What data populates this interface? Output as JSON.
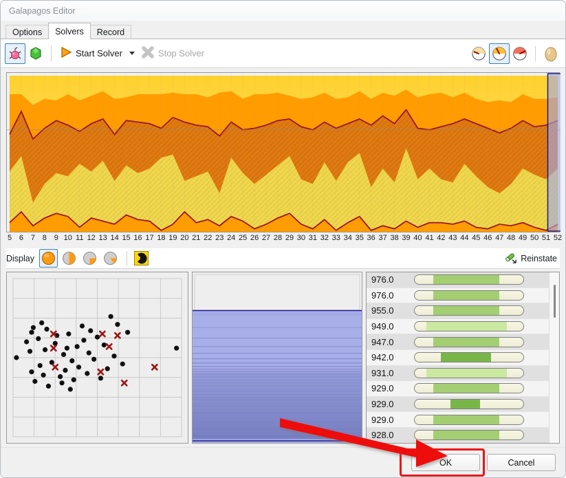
{
  "window": {
    "title": "Galapagos Editor"
  },
  "tabs": [
    {
      "label": "Options",
      "active": false
    },
    {
      "label": "Solvers",
      "active": true
    },
    {
      "label": "Record",
      "active": false
    }
  ],
  "toolbar": {
    "bug_icon": "bug-icon",
    "gem_icon": "gem-icon",
    "start_label": "Start Solver",
    "start_icon": "play-triangle-icon",
    "start_dropdown_icon": "chevron-down-icon",
    "stop_label": "Stop Solver",
    "stop_icon": "x-cross-icon",
    "stop_enabled": false,
    "right_icons": [
      {
        "name": "gauge-slow-icon",
        "selected": false
      },
      {
        "name": "gauge-medium-icon",
        "selected": true
      },
      {
        "name": "gauge-fast-icon",
        "selected": false
      },
      {
        "name": "egg-icon",
        "selected": false
      }
    ]
  },
  "display": {
    "label": "Display",
    "buttons": [
      {
        "name": "display-full-icon",
        "fill": 1.0,
        "selected": true
      },
      {
        "name": "display-half-icon",
        "fill": 0.5,
        "selected": false
      },
      {
        "name": "display-quarter-icon",
        "fill": 0.25,
        "selected": false
      },
      {
        "name": "display-wedge-icon",
        "fill": 0.12,
        "selected": false
      }
    ],
    "radiation_icon": "radiation-icon",
    "reinstate_label": "Reinstate",
    "reinstate_icon": "reinstate-icon"
  },
  "chart_data": {
    "type": "area",
    "title": "",
    "xlabel": "",
    "ylabel": "",
    "grid": true,
    "legend": false,
    "selected_x": 52,
    "colors": {
      "band_top": "#FFD94A",
      "band_upper": "#FF9C00",
      "band_mid": "#E07A10",
      "band_lower": "#E8D24B",
      "line": "#9B1616",
      "background": "#FFFFFF",
      "selection": "#9FA8E8"
    },
    "x": [
      5,
      6,
      7,
      8,
      9,
      10,
      11,
      12,
      13,
      14,
      15,
      16,
      17,
      18,
      19,
      20,
      21,
      22,
      23,
      24,
      25,
      26,
      27,
      28,
      29,
      30,
      31,
      32,
      33,
      34,
      35,
      36,
      37,
      38,
      39,
      40,
      41,
      42,
      43,
      44,
      45,
      46,
      47,
      48,
      49,
      50,
      51,
      52
    ],
    "series": [
      {
        "name": "maximum",
        "values": [
          100,
          100,
          100,
          100,
          100,
          100,
          100,
          100,
          100,
          100,
          100,
          100,
          100,
          100,
          100,
          100,
          100,
          100,
          100,
          100,
          100,
          100,
          100,
          100,
          100,
          100,
          100,
          100,
          100,
          100,
          100,
          100,
          100,
          100,
          100,
          100,
          100,
          100,
          100,
          100,
          100,
          100,
          100,
          100,
          100,
          100,
          100,
          100
        ]
      },
      {
        "name": "upper-quartile",
        "values": [
          88,
          88,
          81,
          85,
          84,
          88,
          84,
          87,
          90,
          85,
          86,
          88,
          88,
          88,
          89,
          88,
          88,
          86,
          89,
          90,
          85,
          88,
          88,
          89,
          87,
          85,
          86,
          89,
          85,
          86,
          90,
          85,
          89,
          87,
          91,
          86,
          88,
          89,
          86,
          89,
          85,
          83,
          84,
          83,
          88,
          85,
          85,
          86
        ]
      },
      {
        "name": "median",
        "values": [
          62,
          77,
          59,
          66,
          71,
          68,
          64,
          69,
          72,
          62,
          71,
          70,
          69,
          66,
          73,
          70,
          68,
          67,
          61,
          70,
          65,
          66,
          68,
          71,
          72,
          67,
          65,
          70,
          66,
          69,
          72,
          68,
          74,
          69,
          78,
          66,
          65,
          67,
          69,
          72,
          69,
          66,
          63,
          66,
          71,
          67,
          68,
          71
        ]
      },
      {
        "name": "lower-quartile",
        "values": [
          38,
          48,
          18,
          30,
          37,
          35,
          43,
          38,
          45,
          32,
          42,
          37,
          40,
          47,
          49,
          32,
          35,
          38,
          24,
          47,
          37,
          30,
          36,
          42,
          48,
          33,
          30,
          44,
          32,
          44,
          50,
          28,
          40,
          31,
          53,
          33,
          40,
          33,
          31,
          43,
          35,
          28,
          24,
          30,
          40,
          36,
          33,
          40
        ]
      },
      {
        "name": "minimum",
        "values": [
          5,
          12,
          3,
          8,
          11,
          9,
          2,
          8,
          6,
          4,
          10,
          7,
          6,
          0,
          4,
          12,
          5,
          7,
          3,
          9,
          6,
          1,
          4,
          8,
          11,
          4,
          1,
          7,
          0,
          5,
          9,
          0,
          3,
          1,
          6,
          2,
          5,
          5,
          4,
          6,
          2,
          1,
          4,
          3,
          5,
          2,
          0,
          4
        ]
      }
    ],
    "xtick_labels": [
      "5",
      "6",
      "7",
      "8",
      "9",
      "10",
      "11",
      "12",
      "13",
      "14",
      "15",
      "16",
      "17",
      "18",
      "19",
      "20",
      "21",
      "22",
      "23",
      "24",
      "25",
      "26",
      "27",
      "28",
      "29",
      "30",
      "31",
      "32",
      "33",
      "34",
      "35",
      "36",
      "37",
      "38",
      "39",
      "40",
      "41",
      "42",
      "43",
      "44",
      "45",
      "46",
      "47",
      "48",
      "49",
      "50",
      "51",
      "52"
    ]
  },
  "scatter_data": {
    "type": "scatter",
    "grid": true,
    "series": [
      {
        "name": "genomes",
        "marker": "dot",
        "color": "#111111",
        "points": [
          [
            0.02,
            0.5
          ],
          [
            0.08,
            0.4
          ],
          [
            0.1,
            0.46
          ],
          [
            0.11,
            0.34
          ],
          [
            0.11,
            0.59
          ],
          [
            0.12,
            0.31
          ],
          [
            0.13,
            0.65
          ],
          [
            0.15,
            0.38
          ],
          [
            0.16,
            0.55
          ],
          [
            0.17,
            0.28
          ],
          [
            0.18,
            0.61
          ],
          [
            0.19,
            0.45
          ],
          [
            0.2,
            0.32
          ],
          [
            0.21,
            0.68
          ],
          [
            0.23,
            0.53
          ],
          [
            0.25,
            0.41
          ],
          [
            0.26,
            0.36
          ],
          [
            0.28,
            0.62
          ],
          [
            0.29,
            0.66
          ],
          [
            0.3,
            0.48
          ],
          [
            0.31,
            0.58
          ],
          [
            0.32,
            0.44
          ],
          [
            0.33,
            0.35
          ],
          [
            0.34,
            0.7
          ],
          [
            0.35,
            0.52
          ],
          [
            0.36,
            0.64
          ],
          [
            0.38,
            0.43
          ],
          [
            0.39,
            0.56
          ],
          [
            0.41,
            0.3
          ],
          [
            0.42,
            0.39
          ],
          [
            0.44,
            0.6
          ],
          [
            0.45,
            0.47
          ],
          [
            0.46,
            0.33
          ],
          [
            0.48,
            0.51
          ],
          [
            0.5,
            0.37
          ],
          [
            0.52,
            0.63
          ],
          [
            0.54,
            0.42
          ],
          [
            0.56,
            0.57
          ],
          [
            0.58,
            0.24
          ],
          [
            0.6,
            0.49
          ],
          [
            0.62,
            0.29
          ],
          [
            0.65,
            0.54
          ],
          [
            0.68,
            0.34
          ],
          [
            0.97,
            0.44
          ]
        ]
      },
      {
        "name": "selected-genomes",
        "marker": "cross",
        "color": "#9B1616",
        "points": [
          [
            0.25,
            0.56
          ],
          [
            0.24,
            0.44
          ],
          [
            0.24,
            0.35
          ],
          [
            0.52,
            0.59
          ],
          [
            0.53,
            0.35
          ],
          [
            0.57,
            0.43
          ],
          [
            0.62,
            0.36
          ],
          [
            0.66,
            0.66
          ],
          [
            0.84,
            0.56
          ]
        ]
      }
    ]
  },
  "bands_panel": {
    "type": "heatmap",
    "empty_top_fraction": 0.22,
    "color": "#A8AEE8",
    "border_color": "#1a1a8c"
  },
  "list": {
    "rows": [
      {
        "value": "976.0",
        "bar_start": 0.17,
        "bar_end": 0.78,
        "shade": "mid"
      },
      {
        "value": "976.0",
        "bar_start": 0.17,
        "bar_end": 0.78,
        "shade": "mid"
      },
      {
        "value": "955.0",
        "bar_start": 0.17,
        "bar_end": 0.78,
        "shade": "mid"
      },
      {
        "value": "949.0",
        "bar_start": 0.11,
        "bar_end": 0.85,
        "shade": "light"
      },
      {
        "value": "947.0",
        "bar_start": 0.17,
        "bar_end": 0.78,
        "shade": "mid"
      },
      {
        "value": "942.0",
        "bar_start": 0.24,
        "bar_end": 0.7,
        "shade": "dark"
      },
      {
        "value": "931.0",
        "bar_start": 0.11,
        "bar_end": 0.85,
        "shade": "light"
      },
      {
        "value": "929.0",
        "bar_start": 0.17,
        "bar_end": 0.78,
        "shade": "mid"
      },
      {
        "value": "929.0",
        "bar_start": 0.33,
        "bar_end": 0.6,
        "shade": "dark"
      },
      {
        "value": "929.0",
        "bar_start": 0.17,
        "bar_end": 0.78,
        "shade": "mid"
      },
      {
        "value": "928.0",
        "bar_start": 0.17,
        "bar_end": 0.78,
        "shade": "mid"
      },
      {
        "value": "",
        "bar_start": 0.17,
        "bar_end": 0.78,
        "shade": "mid"
      }
    ],
    "bar_colors": {
      "light": "#cbe8a0",
      "mid": "#a3ce72",
      "dark": "#79b64a"
    }
  },
  "footer": {
    "ok_label": "OK",
    "cancel_label": "Cancel"
  },
  "annotation": {
    "arrow_color": "#ee1111",
    "highlight_color": "#ee1111"
  }
}
